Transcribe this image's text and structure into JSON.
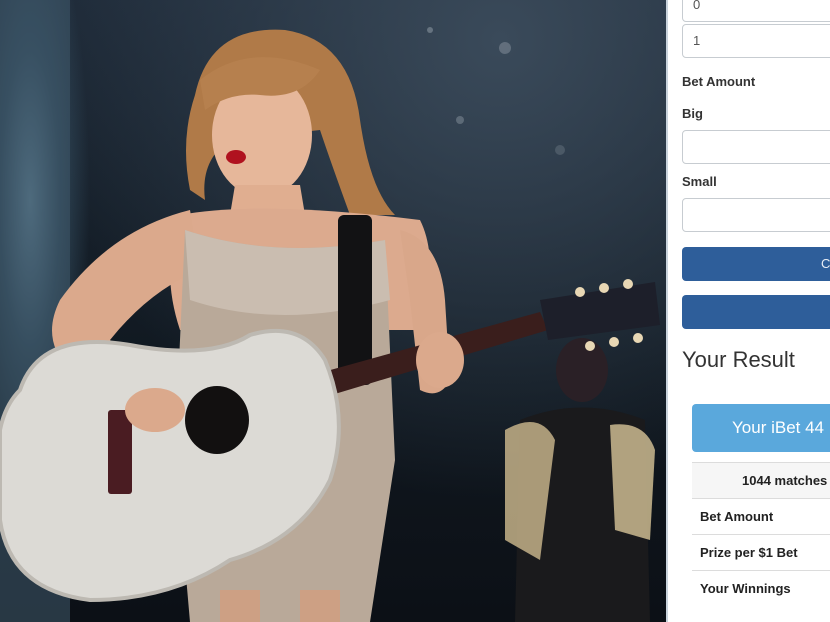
{
  "photo": {
    "description_icon": "concert-photo"
  },
  "form": {
    "inputs": [
      {
        "value": "0"
      },
      {
        "value": "1"
      }
    ],
    "bet_amount_heading": "Bet Amount",
    "big_label": "Big",
    "big_value": "",
    "small_label": "Small",
    "small_value": "",
    "button_1_label": "C",
    "button_2_label": ""
  },
  "result": {
    "heading": "Your Result",
    "ibet_label": "Your iBet 44",
    "matches_text": "1044 matches",
    "rows": [
      {
        "label": "Bet Amount"
      },
      {
        "label": "Prize per $1 Bet"
      },
      {
        "label": "Your Winnings"
      }
    ]
  },
  "colors": {
    "primary_button": "#2e5e9a",
    "ibet_button": "#5aa8dc"
  }
}
